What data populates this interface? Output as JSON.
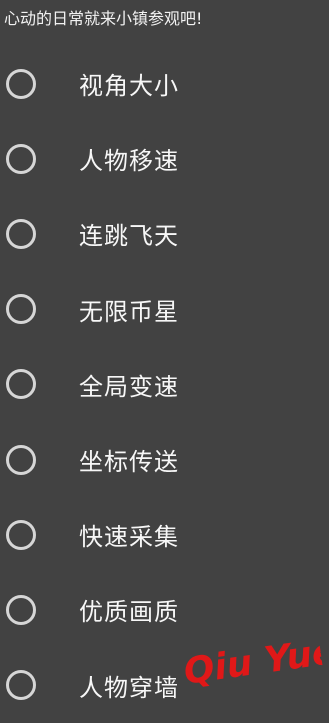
{
  "header": {
    "title": "心动的日常就来小镇参观吧!"
  },
  "options": [
    {
      "label": "视角大小"
    },
    {
      "label": "人物移速"
    },
    {
      "label": "连跳飞天"
    },
    {
      "label": "无限币星"
    },
    {
      "label": "全局变速"
    },
    {
      "label": "坐标传送"
    },
    {
      "label": "快速采集"
    },
    {
      "label": "优质画质"
    },
    {
      "label": "人物穿墙"
    }
  ],
  "watermark": {
    "text": "Qiu Yue",
    "color": "#e01818"
  },
  "colors": {
    "background": "#424242",
    "radio_border": "#d6d6d6",
    "text": "#f7f7f7"
  }
}
